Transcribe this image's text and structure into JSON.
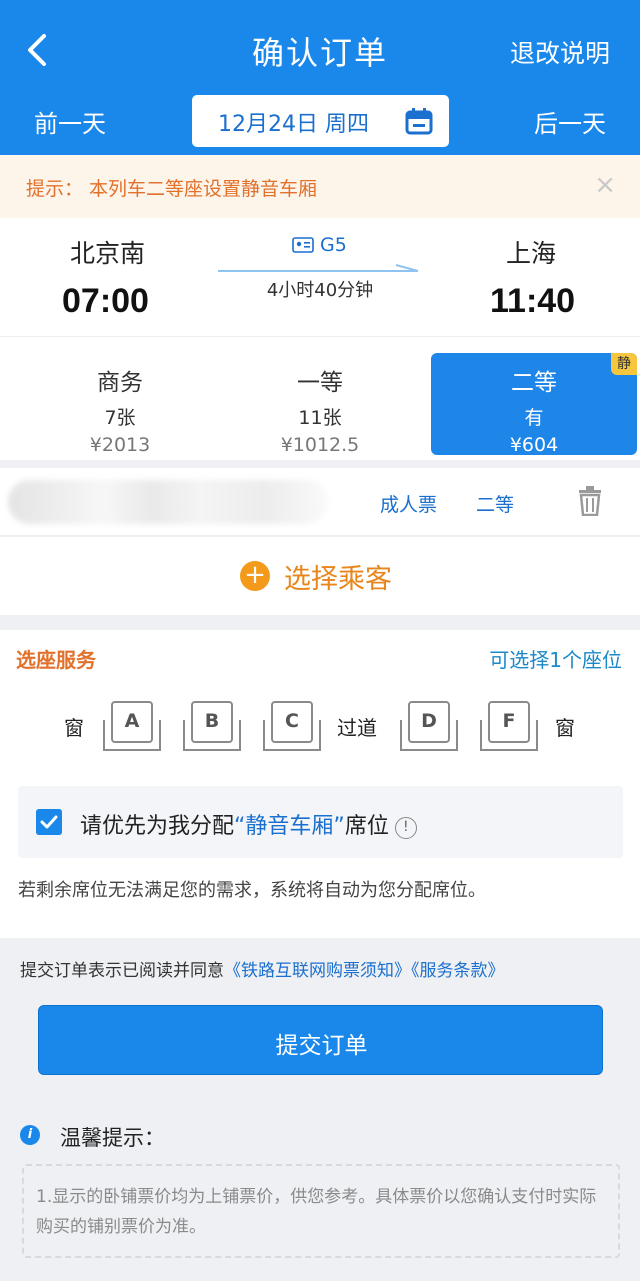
{
  "header": {
    "title": "确认订单",
    "refund_label": "退改说明",
    "prev_day_label": "前一天",
    "next_day_label": "后一天",
    "date_text": "12月24日 周四"
  },
  "tip": {
    "text": "提示：  本列车二等座设置静音车厢",
    "close": "×"
  },
  "train": {
    "from_station": "北京南",
    "to_station": "上海",
    "departure_time": "07:00",
    "arrival_time": "11:40",
    "train_no": "G5",
    "duration": "4小时40分钟"
  },
  "seat_classes": [
    {
      "name": "商务",
      "count": "7张",
      "price": "¥2013"
    },
    {
      "name": "一等",
      "count": "11张",
      "price": "¥1012.5"
    },
    {
      "name": "二等",
      "count": "有",
      "price": "¥604",
      "badge": "静",
      "selected": true
    }
  ],
  "passenger": {
    "ticket_type": "成人票",
    "seat_class": "二等"
  },
  "add_passenger_label": "选择乘客",
  "seat_service": {
    "title": "选座服务",
    "hint": "可选择1个座位",
    "window_left": "窗",
    "aisle": "过道",
    "window_right": "窗",
    "seats": [
      "A",
      "B",
      "C",
      "D",
      "F"
    ],
    "pref_prefix": "请优先为我分配",
    "pref_highlight": "“静音车厢”",
    "pref_suffix": "席位",
    "pref_checked": true,
    "auto_note": "若剩余席位无法满足您的需求，系统将自动为您分配席位。"
  },
  "agreement": {
    "prefix": "提交订单表示已阅读并同意",
    "link1": "《铁路互联网购票须知》",
    "link2": "《服务条款》"
  },
  "submit_label": "提交订单",
  "warm_tip": {
    "title": "温馨提示：",
    "text": "1.显示的卧铺票价均为上铺票价，供您参考。具体票价以您确认支付时实际购买的铺别票价为准。"
  },
  "colors": {
    "primary": "#1a88ea",
    "accent_orange": "#e2712c",
    "link_blue": "#1a6fcf"
  }
}
